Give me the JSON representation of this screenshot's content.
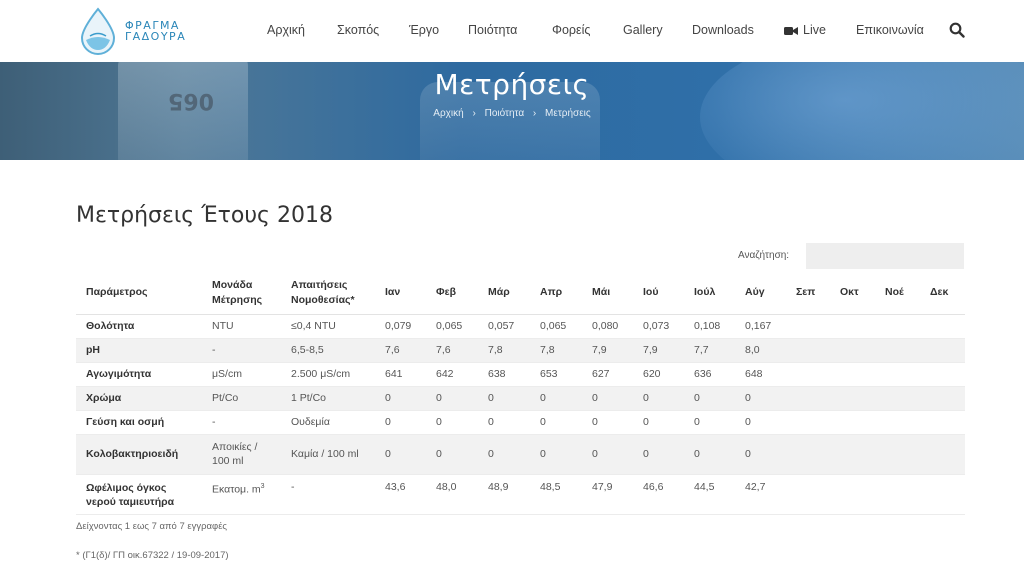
{
  "logo": {
    "line1": "ΦΡΑΓΜΑ",
    "line2": "ΓΑΔΟΥΡΑ"
  },
  "nav": {
    "items": [
      "Αρχική",
      "Σκοπός",
      "Έργο",
      "Ποιότητα",
      "Φορείς",
      "Gallery",
      "Downloads",
      "Live",
      "Επικοινωνία"
    ]
  },
  "banner": {
    "title": "Μετρήσεις",
    "bottle_label": "065",
    "breadcrumb": [
      "Αρχική",
      "Ποιότητα",
      "Μετρήσεις"
    ],
    "separator": "›"
  },
  "main": {
    "title": "Μετρήσεις Έτους 2018",
    "search_label": "Αναζήτηση:",
    "search_value": "",
    "info": "Δείχνοντας 1 εως 7 από 7 εγγραφές",
    "footnote": "* (Γ1(δ)/ ΓΠ οικ.67322 / 19-09-2017)"
  },
  "table": {
    "headers": [
      "Παράμετρος",
      "Μονάδα Μέτρησης",
      "Απαιτήσεις Νομοθεσίας*",
      "Ιαν",
      "Φεβ",
      "Μάρ",
      "Απρ",
      "Μάι",
      "Ιού",
      "Ιούλ",
      "Αύγ",
      "Σεπ",
      "Οκτ",
      "Νοέ",
      "Δεκ"
    ],
    "rows": [
      [
        "Θολότητα",
        "NTU",
        "≤0,4 NTU",
        "0,079",
        "0,065",
        "0,057",
        "0,065",
        "0,080",
        "0,073",
        "0,108",
        "0,167",
        "",
        "",
        "",
        ""
      ],
      [
        "pH",
        "-",
        "6,5-8,5",
        "7,6",
        "7,6",
        "7,8",
        "7,8",
        "7,9",
        "7,9",
        "7,7",
        "8,0",
        "",
        "",
        "",
        ""
      ],
      [
        "Αγωγιμότητα",
        "μS/cm",
        "2.500 μS/cm",
        "641",
        "642",
        "638",
        "653",
        "627",
        "620",
        "636",
        "648",
        "",
        "",
        "",
        ""
      ],
      [
        "Χρώμα",
        "Pt/Co",
        "1 Pt/Co",
        "0",
        "0",
        "0",
        "0",
        "0",
        "0",
        "0",
        "0",
        "",
        "",
        "",
        ""
      ],
      [
        "Γεύση και οσμή",
        "-",
        "Ουδεμία",
        "0",
        "0",
        "0",
        "0",
        "0",
        "0",
        "0",
        "0",
        "",
        "",
        "",
        ""
      ],
      [
        "Κολοβακτηριοειδή",
        "Αποικίες / 100 ml",
        "Καμία / 100 ml",
        "0",
        "0",
        "0",
        "0",
        "0",
        "0",
        "0",
        "0",
        "",
        "",
        "",
        ""
      ],
      [
        "Ωφέλιμος όγκος νερού ταμιευτήρα",
        "Εκατομ. m",
        "-",
        "43,6",
        "48,0",
        "48,9",
        "48,5",
        "47,9",
        "46,6",
        "44,5",
        "42,7",
        "",
        "",
        "",
        ""
      ]
    ],
    "unit_superscript": "3"
  },
  "colors": {
    "brand": "#2a86b8",
    "banner": "#2f6fa8",
    "stripe": "#f2f2f2"
  }
}
